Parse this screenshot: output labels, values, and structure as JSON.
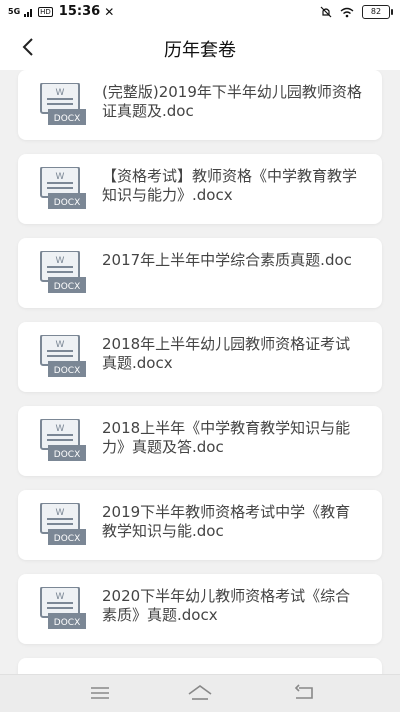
{
  "status_bar": {
    "signal": "5G",
    "network_badge": "HD",
    "time": "15:36",
    "battery": "82"
  },
  "header": {
    "title": "历年套卷",
    "back_icon": "chevron-left-icon"
  },
  "documents": [
    {
      "title": "(完整版)2019年下半年幼儿园教师资格证真题及.doc",
      "icon_label": "DOCX",
      "icon_letter": "W"
    },
    {
      "title": "【资格考试】教师资格《中学教育教学知识与能力》.docx",
      "icon_label": "DOCX",
      "icon_letter": "W"
    },
    {
      "title": "2017年上半年中学综合素质真题.doc",
      "icon_label": "DOCX",
      "icon_letter": "W"
    },
    {
      "title": "2018年上半年幼儿园教师资格证考试真题.docx",
      "icon_label": "DOCX",
      "icon_letter": "W"
    },
    {
      "title": "2018上半年《中学教育教学知识与能力》真题及答.doc",
      "icon_label": "DOCX",
      "icon_letter": "W"
    },
    {
      "title": "2019下半年教师资格考试中学《教育教学知识与能.doc",
      "icon_label": "DOCX",
      "icon_letter": "W"
    },
    {
      "title": "2020下半年幼儿教师资格考试《综合素质》真题.docx",
      "icon_label": "DOCX",
      "icon_letter": "W"
    }
  ],
  "nav": {
    "menu_icon": "menu-icon",
    "home_icon": "home-icon",
    "back_icon": "back-arrow-icon"
  },
  "colors": {
    "background": "#f1f1f1",
    "card": "#ffffff",
    "file_icon": "#7b8795"
  }
}
